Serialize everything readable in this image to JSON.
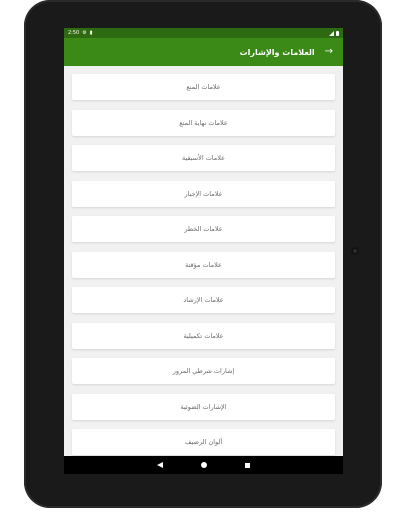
{
  "status_bar": {
    "time": "2:50",
    "icons_left": [
      "settings-icon",
      "sd-card-icon"
    ],
    "icons_right": [
      "wifi-icon",
      "battery-icon"
    ]
  },
  "app_bar": {
    "title": "العلامات والإشارات",
    "back_icon": "arrow-right-icon",
    "back_glyph": "→"
  },
  "colors": {
    "status_bar": "#2e6a12",
    "app_bar": "#3b8a17",
    "background": "#f1f1f1",
    "card": "#ffffff",
    "card_text": "#6b6b6b"
  },
  "items": [
    {
      "label": "علامات المنع"
    },
    {
      "label": "علامات نهاية المنع"
    },
    {
      "label": "علامات الأسبقية"
    },
    {
      "label": "علامات الإجبار"
    },
    {
      "label": "علامات الخطر"
    },
    {
      "label": "علامات مؤقتة"
    },
    {
      "label": "علامات الإرشاد"
    },
    {
      "label": "علامات تكميلية"
    },
    {
      "label": "إشارات شرطي المرور"
    },
    {
      "label": "الإشارات الضوئية"
    },
    {
      "label": "ألوان الرصيف"
    }
  ],
  "nav_bar": {
    "icons": [
      "nav-back-icon",
      "nav-home-icon",
      "nav-recents-icon"
    ]
  }
}
